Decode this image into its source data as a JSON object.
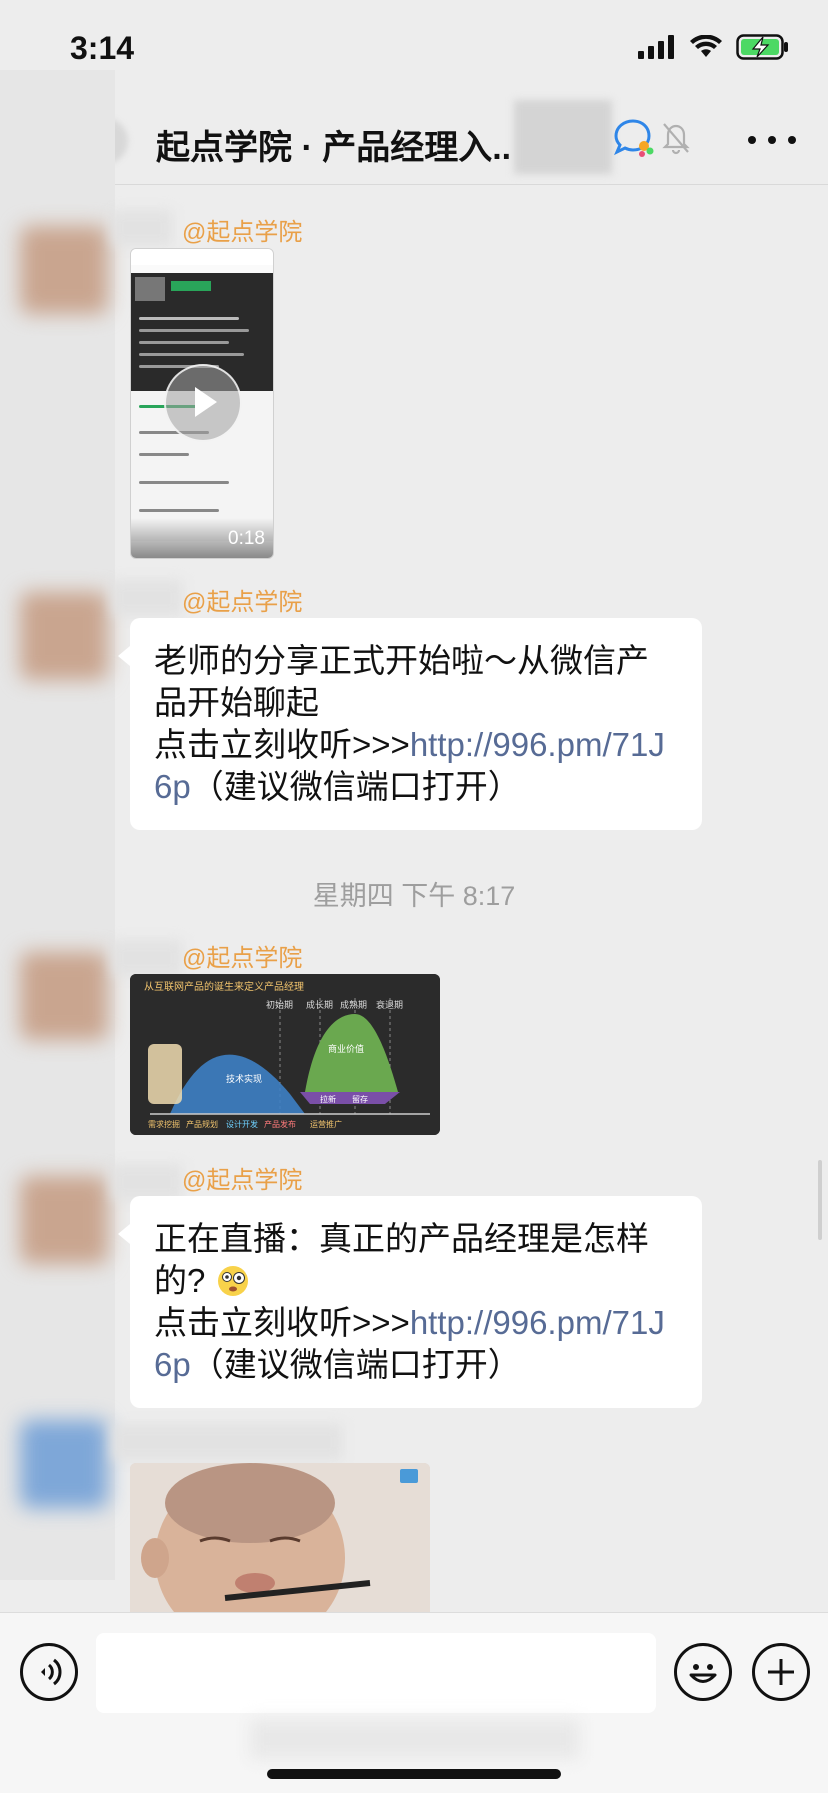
{
  "status_bar": {
    "time": "3:14"
  },
  "nav": {
    "title": "起点学院 · 产品经理入.."
  },
  "messages": {
    "m1": {
      "sender": "@起点学院",
      "video_duration": "0:18"
    },
    "m2": {
      "sender": "@起点学院",
      "text_line1": "老师的分享正式开始啦～从微信产品开始聊起",
      "text_prefix": "点击立刻收听>>>",
      "link": "http://996.pm/71J6p",
      "text_suffix": "（建议微信端口打开）"
    },
    "time_divider": "星期四 下午 8:17",
    "m3": {
      "sender": "@起点学院",
      "diagram_title": "从互联网产品的诞生来定义产品经理",
      "stages": [
        "初始期",
        "成长期",
        "成熟期",
        "衰退期"
      ],
      "labels": [
        "技术实现",
        "商业价值",
        "拉新",
        "留存",
        "需求挖掘",
        "产品规划",
        "设计开发",
        "产品发布",
        "运营推广"
      ]
    },
    "m4": {
      "sender": "@起点学院",
      "text_line1": "正在直播：真正的产品经理是怎样的?",
      "text_prefix": "点击立刻收听>>>",
      "link": "http://996.pm/71J6p",
      "text_suffix": "（建议微信端口打开）"
    }
  },
  "colors": {
    "link": "#576b95",
    "sender": "#e9a048",
    "background": "#ededed"
  }
}
